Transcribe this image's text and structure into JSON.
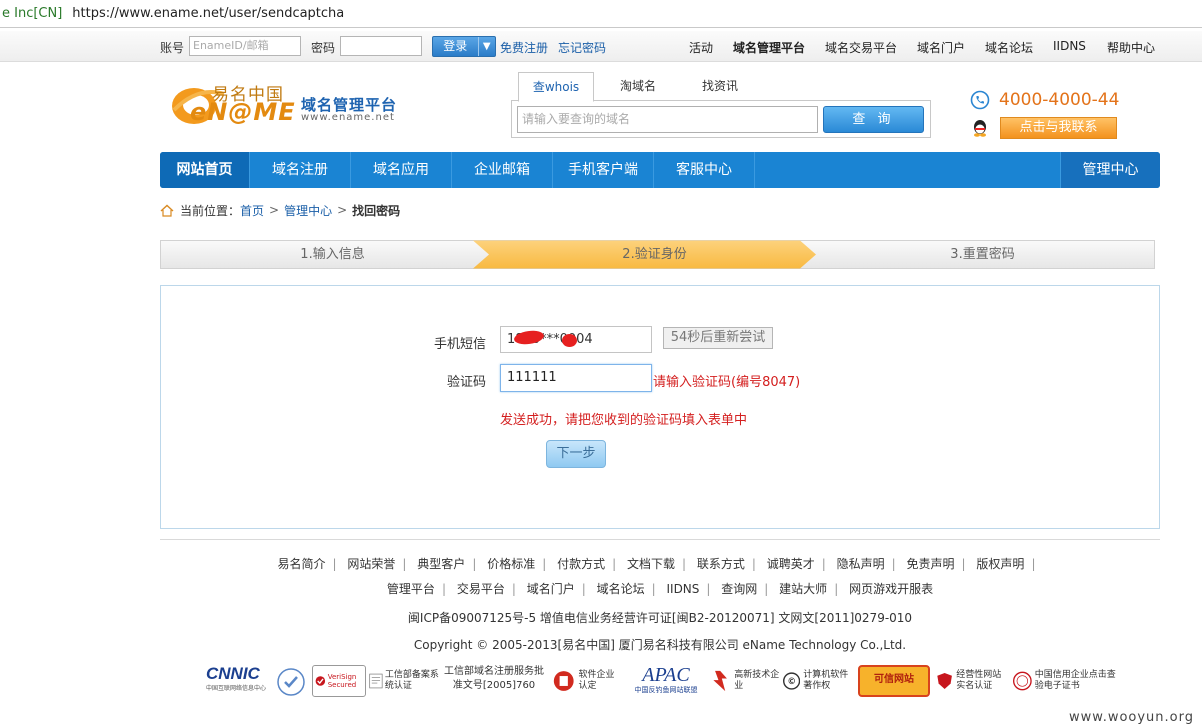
{
  "browser": {
    "identity": "e Inc[CN]",
    "url": "https://www.ename.net/user/sendcaptcha"
  },
  "topbar": {
    "account_label": "账号",
    "account_placeholder": "EnameID/邮箱",
    "password_label": "密码",
    "login_label": "登录",
    "register_label": "免费注册",
    "forgot_label": "忘记密码",
    "nav": [
      "活动",
      "域名管理平台",
      "域名交易平台",
      "域名门户",
      "域名论坛",
      "IIDNS",
      "帮助中心"
    ]
  },
  "header": {
    "logo_cn": "易名中国",
    "logo_word": "eN@ME",
    "platform": "域名管理平台",
    "site": "www.ename.net",
    "search_tabs": [
      "查whois",
      "淘域名",
      "找资讯"
    ],
    "search_placeholder": "请输入要查询的域名",
    "search_button": "查 询",
    "phone": "4000-4000-44",
    "contact_button": "点击与我联系"
  },
  "nav": [
    "网站首页",
    "域名注册",
    "域名应用",
    "企业邮箱",
    "手机客户端",
    "客服中心"
  ],
  "nav_admin": "管理中心",
  "breadcrumb": {
    "label": "当前位置：",
    "home": "首页",
    "admin": "管理中心",
    "current": "找回密码",
    "sep": ">"
  },
  "steps": [
    "1.输入信息",
    "2.验证身份",
    "3.重置密码"
  ],
  "form": {
    "sms_label": "手机短信",
    "phone_value": "1860***0004",
    "retry_label": "54秒后重新尝试",
    "code_label": "验证码",
    "code_value": "111111",
    "code_hint": "请输入验证码(编号8047)",
    "sent_message": "发送成功，请把您收到的验证码填入表单中",
    "next_label": "下一步"
  },
  "footer": {
    "links1": [
      "易名简介",
      "网站荣誉",
      "典型客户",
      "价格标准",
      "付款方式",
      "文档下载",
      "联系方式",
      "诚聘英才",
      "隐私声明",
      "免责声明",
      "版权声明"
    ],
    "links2": [
      "管理平台",
      "交易平台",
      "域名门户",
      "域名论坛",
      "IIDNS",
      "查询网",
      "建站大师",
      "网页游戏开服表"
    ],
    "icp": "闽ICP备09007125号-5 增值电信业务经营许可证[闽B2-20120071] 文网文[2011]0279-010",
    "copyright": "Copyright © 2005-2013[易名中国] 厦门易名科技有限公司 eName Technology Co.,Ltd.",
    "badges": {
      "cnnic": "CNNIC",
      "cnnic_sub": "中国互联网络信息中心",
      "verisign": "VeriSign Secured",
      "miit1": "工信部备案系统认证",
      "miit2": "工信部域名注册服务批准文号[2005]760",
      "soft": "软件企业认定",
      "apac": "APAC",
      "apac_sub": "中国反钓鱼网站联盟",
      "hitech": "高新技术企业",
      "copyright_reg": "计算机软件著作权",
      "cred": "可信网站",
      "realname": "经营性网站实名认证",
      "credit": "中国信用企业点击查验电子证书"
    }
  },
  "watermark": "www.wooyun.org",
  "colors": {
    "primary": "#1a84d3",
    "accent_orange": "#f3921d",
    "error_red": "#d42020",
    "step_active": "#fbc661"
  }
}
